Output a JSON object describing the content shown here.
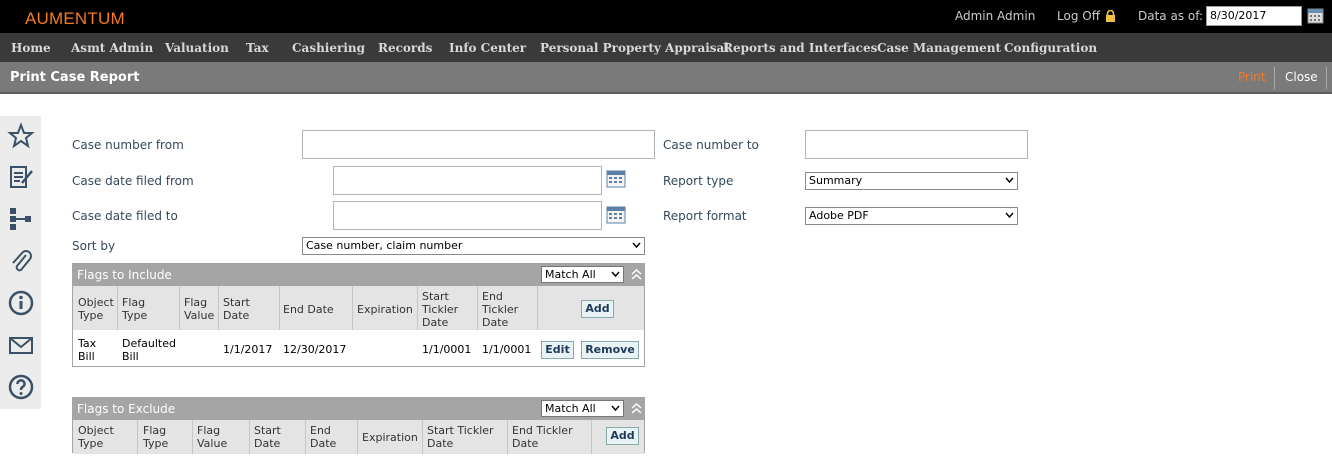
{
  "app": {
    "logo": "AUMENTUM"
  },
  "header": {
    "user": "Admin Admin",
    "logoff": "Log Off",
    "data_as_of_label": "Data as of:",
    "data_as_of_value": "8/30/2017"
  },
  "menu": [
    "Home",
    "Asmt Admin",
    "Valuation",
    "Tax",
    "Cashiering",
    "Records",
    "Info Center",
    "Personal Property Appraisal",
    "Reports and Interfaces",
    "Case Management",
    "Configuration"
  ],
  "titlebar": {
    "title": "Print Case Report",
    "print": "Print",
    "close": "Close"
  },
  "sidebar": [
    "star-icon",
    "edit-notes-icon",
    "hierarchy-icon",
    "paperclip-icon",
    "info-icon",
    "mail-icon",
    "help-icon"
  ],
  "form": {
    "case_number_from_label": "Case number from",
    "case_number_to_label": "Case number to",
    "case_date_from_label": "Case date filed from",
    "case_date_to_label": "Case date filed to",
    "report_type_label": "Report type",
    "report_type_value": "Summary",
    "report_format_label": "Report format",
    "report_format_value": "Adobe PDF",
    "sort_by_label": "Sort by",
    "sort_by_value": "Case number, claim number"
  },
  "include": {
    "title": "Flags to Include",
    "match": "Match All",
    "columns": [
      "Object Type",
      "Flag Type",
      "Flag Value",
      "Start Date",
      "End Date",
      "Expiration",
      "Start Tickler Date",
      "End Tickler Date"
    ],
    "add": "Add",
    "rows": [
      {
        "object_type": "Tax Bill",
        "flag_type": "Defaulted Bill",
        "flag_value": "",
        "start_date": "1/1/2017",
        "end_date": "12/30/2017",
        "expiration": "",
        "start_tickler": "1/1/0001",
        "end_tickler": "1/1/0001",
        "edit": "Edit",
        "remove": "Remove"
      }
    ]
  },
  "exclude": {
    "title": "Flags to Exclude",
    "match": "Match All",
    "columns": [
      "Object Type",
      "Flag Type",
      "Flag Value",
      "Start Date",
      "End Date",
      "Expiration",
      "Start Tickler Date",
      "End Tickler Date"
    ],
    "add": "Add"
  }
}
